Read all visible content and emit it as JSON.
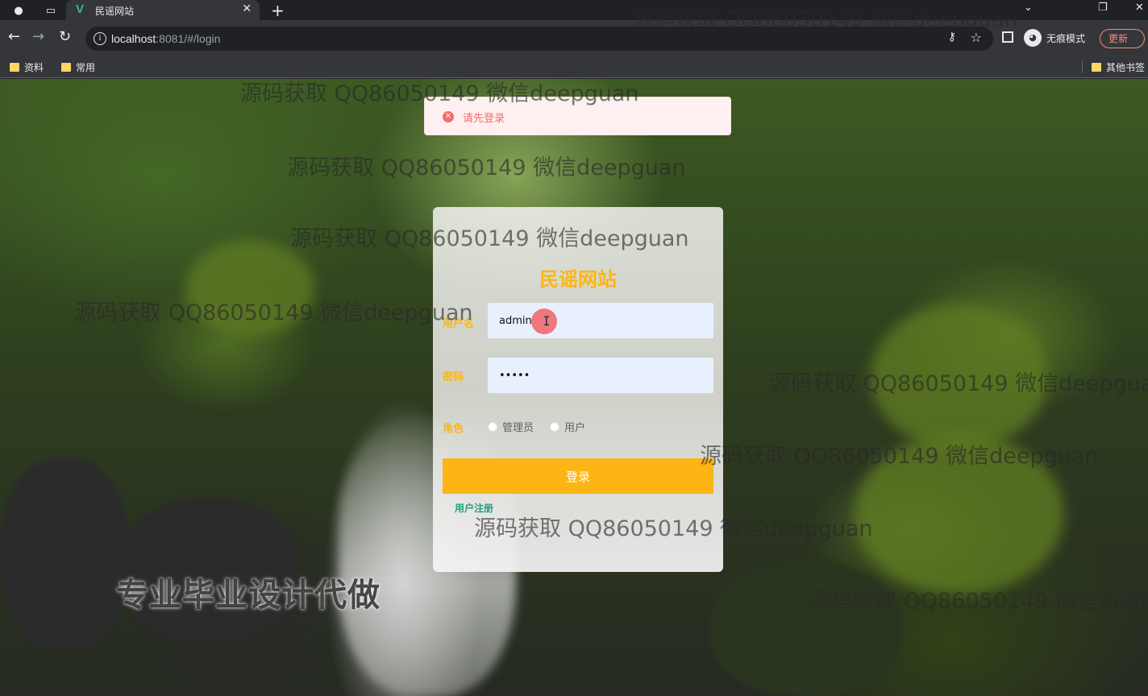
{
  "browser": {
    "tab_title": "民谣网站",
    "url_host": "localhost",
    "url_rest": ":8081/#/login",
    "incognito_label": "无痕模式",
    "update_label": "更新",
    "bookmarks": [
      "资料",
      "常用"
    ],
    "other_bookmarks": "其他书签"
  },
  "toast": {
    "message": "请先登录"
  },
  "login": {
    "site_title": "民谣网站",
    "username_label": "用户名",
    "username_value": "admin",
    "password_label": "密码",
    "password_value": "•••••",
    "role_label": "角色",
    "roles": [
      "管理员",
      "用户"
    ],
    "login_button": "登录",
    "register_link": "用户注册"
  },
  "overlay": {
    "watermark": "源码获取 QQ86050149 微信deepguan",
    "promo": "专业毕业设计代做"
  },
  "colors": {
    "accent": "#fdb515",
    "link": "#20a080",
    "error": "#f56c6c"
  }
}
